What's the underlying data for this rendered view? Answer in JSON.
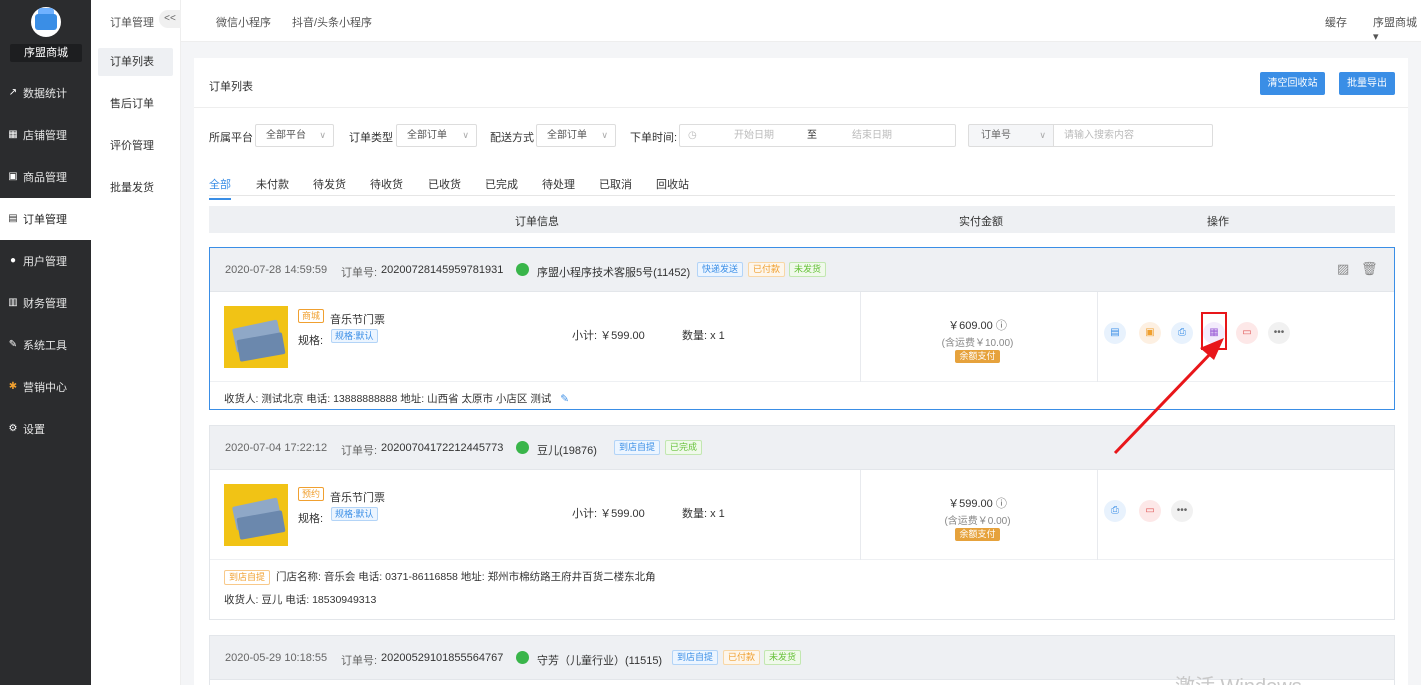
{
  "sidebar": {
    "shop_name": "序盟商城",
    "items": [
      {
        "label": "数据统计",
        "icon": "chart-icon"
      },
      {
        "label": "店铺管理",
        "icon": "store-icon"
      },
      {
        "label": "商品管理",
        "icon": "goods-icon"
      },
      {
        "label": "订单管理",
        "icon": "order-icon"
      },
      {
        "label": "用户管理",
        "icon": "user-icon"
      },
      {
        "label": "财务管理",
        "icon": "finance-icon"
      },
      {
        "label": "系统工具",
        "icon": "wrench-icon"
      },
      {
        "label": "营销中心",
        "icon": "marketing-icon"
      },
      {
        "label": "设置",
        "icon": "gear-icon"
      }
    ]
  },
  "subsidebar": {
    "title": "订单管理",
    "collapse": "<<",
    "items": [
      "订单列表",
      "售后订单",
      "评价管理",
      "批量发货"
    ]
  },
  "topbar": {
    "tabs": [
      "微信小程序",
      "抖音/头条小程序"
    ],
    "cache": "缓存",
    "user": "序盟商城"
  },
  "card": {
    "title": "订单列表",
    "btn_clear": "清空回收站",
    "btn_export": "批量导出"
  },
  "filters": {
    "platform_label": "所属平台",
    "platform_value": "全部平台",
    "type_label": "订单类型",
    "type_value": "全部订单",
    "delivery_label": "配送方式",
    "delivery_value": "全部订单",
    "time_label": "下单时间:",
    "start_ph": "开始日期",
    "to": "至",
    "end_ph": "结束日期",
    "search_field": "订单号",
    "search_ph": "请输入搜索内容"
  },
  "status_tabs": [
    "全部",
    "未付款",
    "待发货",
    "待收货",
    "已收货",
    "已完成",
    "待处理",
    "已取消",
    "回收站"
  ],
  "table_head": {
    "info": "订单信息",
    "amount": "实付金额",
    "ops": "操作"
  },
  "orders": [
    {
      "time": "2020-07-28 14:59:59",
      "no_label": "订单号:",
      "no": "20200728145959781931",
      "buyer": "序盟小程序技术客服5号(11452)",
      "tags": [
        {
          "t": "快递发送",
          "c": "blue"
        },
        {
          "t": "已付款",
          "c": "orange"
        },
        {
          "t": "未发货",
          "c": "green"
        }
      ],
      "product_tag": "商城",
      "product": "音乐节门票",
      "spec_label": "规格:",
      "spec": "规格:默认",
      "subtotal": "小计: ￥599.00",
      "qty": "数量: x 1",
      "amount": "￥609.00",
      "fee": "(含运费￥10.00)",
      "pay": "余额支付",
      "addr": "收货人: 测试北京 电话: 13888888888 地址: 山西省 太原市 小店区 测试"
    },
    {
      "time": "2020-07-04 17:22:12",
      "no_label": "订单号:",
      "no": "20200704172212445773",
      "buyer": "豆儿(19876)",
      "tags": [
        {
          "t": "到店自提",
          "c": "blue"
        },
        {
          "t": "已完成",
          "c": "green"
        }
      ],
      "product_tag": "预约",
      "product": "音乐节门票",
      "spec_label": "规格:",
      "spec": "规格:默认",
      "subtotal": "小计: ￥599.00",
      "qty": "数量: x 1",
      "amount": "￥599.00",
      "fee": "(含运费￥0.00)",
      "pay": "余额支付",
      "store_tag": "到店自提",
      "store": "门店名称: 音乐会 电话: 0371-86116858 地址: 郑州市棉纺路王府井百货二楼东北角",
      "addr": "收货人: 豆儿 电话: 18530949313"
    },
    {
      "time": "2020-05-29 10:18:55",
      "no_label": "订单号:",
      "no": "20200529101855564767",
      "buyer": "守芳（儿童行业）(11515)",
      "tags": [
        {
          "t": "到店自提",
          "c": "blue"
        },
        {
          "t": "已付款",
          "c": "orange"
        },
        {
          "t": "未发货",
          "c": "green"
        }
      ]
    }
  ],
  "watermark": "激活 Windows"
}
